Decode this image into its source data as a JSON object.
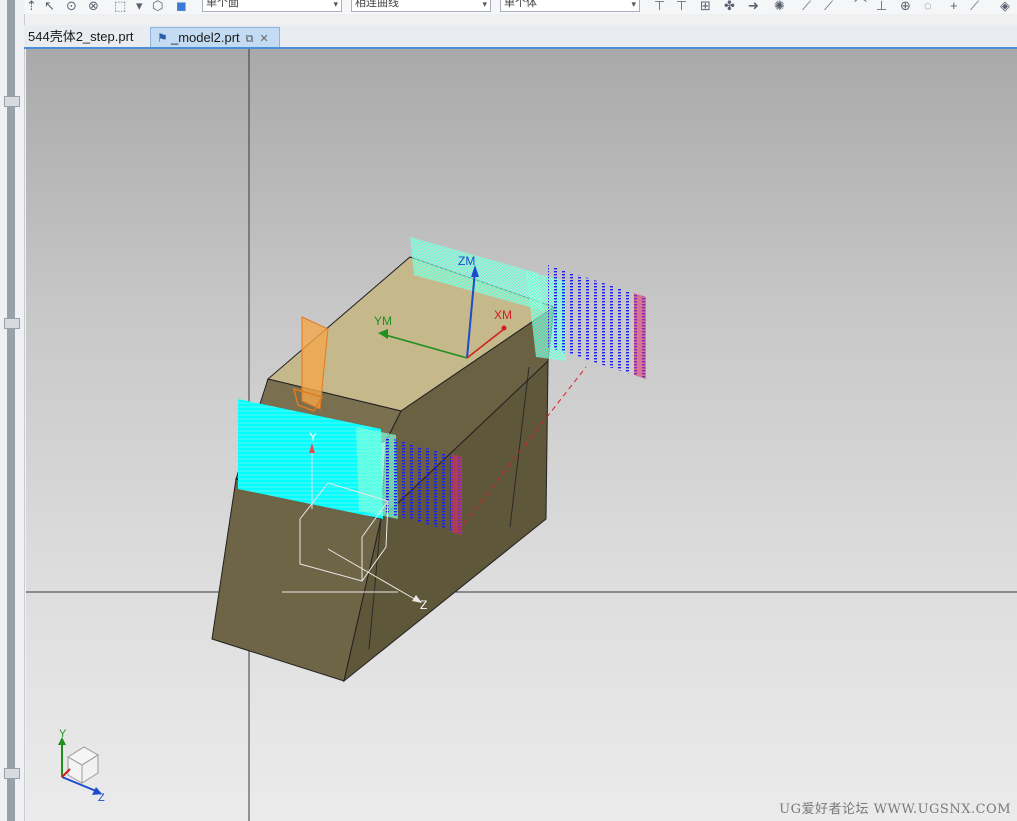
{
  "toolbar": {
    "select_face": "单个面",
    "select_curve": "相连曲线",
    "select_body": "单个体",
    "dropdown_arrow": "▾"
  },
  "tabs": [
    {
      "label": "544壳体2_step.prt",
      "active": false
    },
    {
      "label": "_model2.prt",
      "active": true
    }
  ],
  "tab_icons": {
    "flag": "flag-icon",
    "edit": "edit-doc-icon",
    "close": "✕"
  },
  "viewport": {
    "csys_labels": {
      "zm": "ZM",
      "ym": "YM",
      "xm": "XM"
    },
    "wcs_labels": {
      "y": "Y",
      "z": "Z"
    },
    "triad_labels": {
      "y": "Y",
      "z": "Z"
    },
    "watermark": "UG爱好者论坛 WWW.UGSNX.COM"
  },
  "colors": {
    "model_top": "#c5b98c",
    "model_front": "#6e6546",
    "model_side": "#5e5638",
    "toolpath_cyan": "#00ffff",
    "toolpath_blue": "#1a1aff",
    "axis_z": "#1a4ccc",
    "axis_y": "#1f8f1f",
    "axis_x": "#d02020"
  }
}
